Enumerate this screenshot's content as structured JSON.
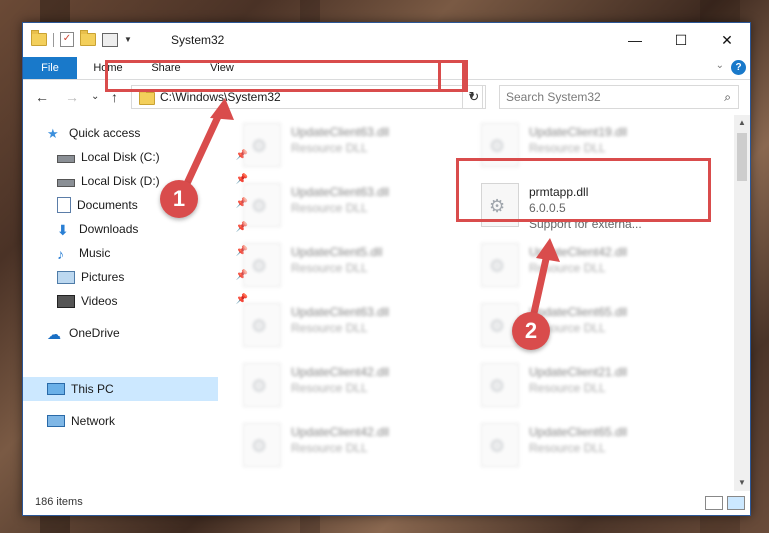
{
  "window": {
    "title": "System32",
    "minimize": "—",
    "maximize": "☐",
    "close": "✕"
  },
  "ribbon": {
    "tabs": [
      "File",
      "Home",
      "Share",
      "View"
    ],
    "help": "?",
    "expand": "⌄"
  },
  "address": {
    "path": "C:\\Windows\\System32",
    "refresh": "↻",
    "search_placeholder": "Search System32",
    "back": "←",
    "forward": "→",
    "recent": "⌄",
    "up": "↑"
  },
  "nav": {
    "items": [
      {
        "label": "Quick access",
        "icon": "star-icon",
        "pinned": false
      },
      {
        "label": "Local Disk (C:)",
        "icon": "drive-icon",
        "pinned": true
      },
      {
        "label": "Local Disk (D:)",
        "icon": "drive-icon",
        "pinned": true
      },
      {
        "label": "Documents",
        "icon": "documents-icon",
        "pinned": true
      },
      {
        "label": "Downloads",
        "icon": "download-icon",
        "pinned": true
      },
      {
        "label": "Music",
        "icon": "music-icon",
        "pinned": true
      },
      {
        "label": "Pictures",
        "icon": "pictures-icon",
        "pinned": true
      },
      {
        "label": "Videos",
        "icon": "videos-icon",
        "pinned": true
      },
      {
        "label": "OneDrive",
        "icon": "cloud-icon",
        "pinned": false
      },
      {
        "label": "This PC",
        "icon": "computer-icon",
        "pinned": false,
        "selected": true
      },
      {
        "label": "Network",
        "icon": "network-icon",
        "pinned": false
      }
    ]
  },
  "files": {
    "left": [
      {
        "name": "UpdateClient63.dll",
        "sub": "Resource DLL"
      },
      {
        "name": "UpdateClient63.dll",
        "sub": "Resource DLL"
      },
      {
        "name": "UpdateClient5.dll",
        "sub": "Resource DLL"
      },
      {
        "name": "UpdateClient63.dll",
        "sub": "Resource DLL"
      },
      {
        "name": "UpdateClient42.dll",
        "sub": "Resource DLL"
      },
      {
        "name": "UpdateClient42.dll",
        "sub": "Resource DLL"
      }
    ],
    "right": [
      {
        "name": "UpdateClient19.dll",
        "sub": "Resource DLL"
      },
      {
        "name": "prmtapp.dll",
        "sub": "6.0.0.5",
        "sub2": "Support for externa..."
      },
      {
        "name": "UpdateClient42.dll",
        "sub": "Resource DLL"
      },
      {
        "name": "UpdateClient65.dll",
        "sub": "Resource DLL"
      },
      {
        "name": "UpdateClient21.dll",
        "sub": "Resource DLL"
      },
      {
        "name": "UpdateClient65.dll",
        "sub": "Resource DLL"
      }
    ]
  },
  "status": {
    "count": "186 items"
  },
  "callouts": [
    "1",
    "2"
  ],
  "colors": {
    "accent": "#1979ca",
    "highlight": "#d94c4c",
    "selected": "#cce8ff"
  }
}
